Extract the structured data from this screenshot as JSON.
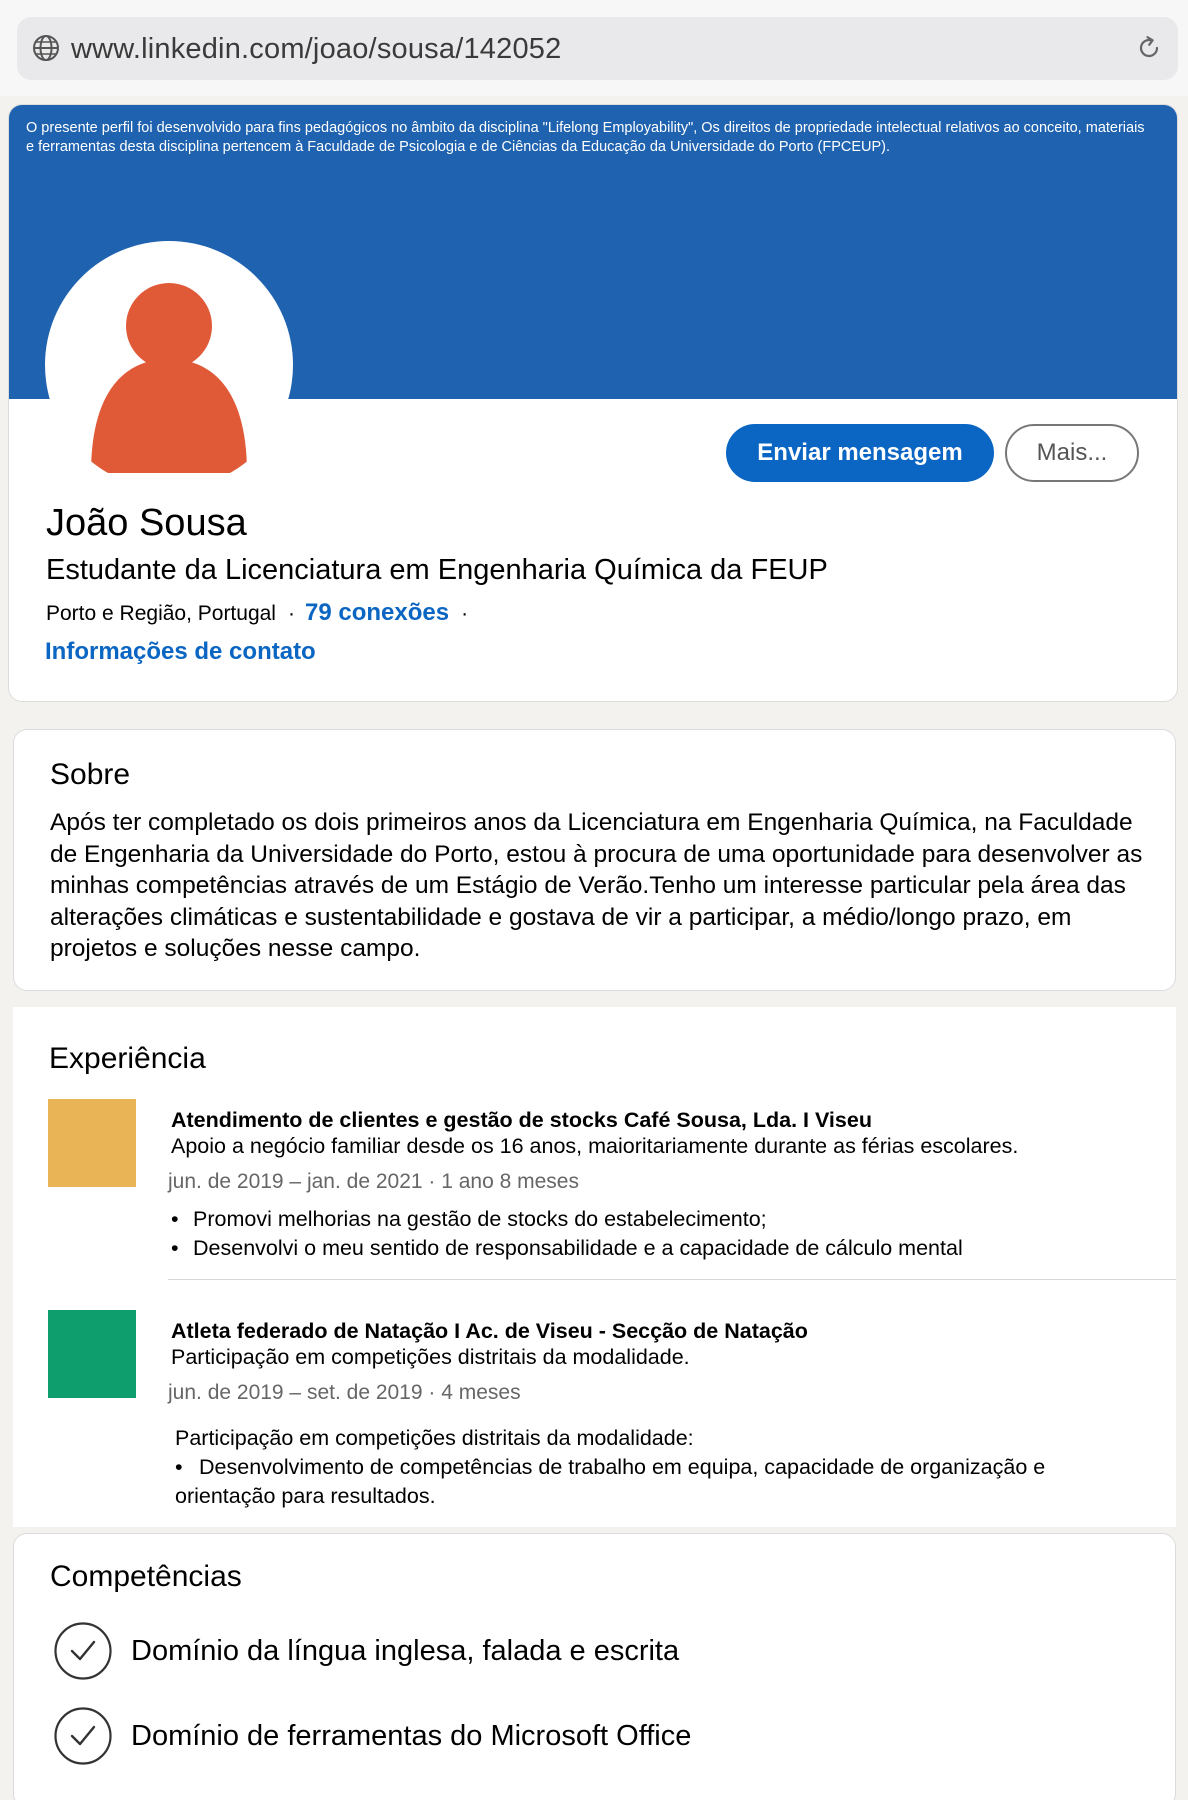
{
  "browser": {
    "url": "www.linkedin.com/joao/sousa/142052"
  },
  "banner": {
    "notice": "O presente perfil foi desenvolvido para fins pedagógicos no âmbito da disciplina \"Lifelong Employability\", Os direitos de propriedade intelectual relativos ao conceito, materiais e ferramentas desta disciplina pertencem à Faculdade de Psicologia e de Ciências da Educação da Universidade do Porto (FPCEUP)."
  },
  "profile": {
    "name": "João Sousa",
    "headline": "Estudante da Licenciatura em Engenharia Química da FEUP",
    "location": "Porto e Região, Portugal",
    "separator": "·",
    "connections": "79 conexões",
    "contact_link": "Informações de contato",
    "avatar_color": "#e05a38"
  },
  "actions": {
    "message_label": "Enviar mensagem",
    "more_label": "Mais..."
  },
  "about": {
    "title": "Sobre",
    "text": "Após ter completado os dois primeiros anos da Licenciatura em Engenharia Química, na Faculdade de Engenharia da Universidade do Porto, estou à procura de uma oportunidade para desenvolver as minhas competências através de um Estágio de Verão.Tenho um interesse particular pela área das alterações climáticas e sustentabilidade e gostava de vir a participar, a médio/longo prazo, em projetos e soluções nesse campo."
  },
  "experience": {
    "title": "Experiência",
    "items": [
      {
        "title": "Atendimento de clientes e gestão de stocks Café Sousa, Lda. I Viseu",
        "description": "Apoio a negócio familiar desde os 16 anos, maioritariamente durante as férias escolares.",
        "dates": "jun. de 2019 – jan. de 2021 · 1 ano 8 meses",
        "logo_color": "#e8b455",
        "bullets": [
          "Promovi melhorias na gestão de stocks do estabelecimento;",
          "Desenvolvi o meu sentido de responsabilidade e a capacidade de cálculo mental"
        ]
      },
      {
        "title": "Atleta federado de Natação I Ac. de Viseu - Secção de Natação",
        "description": "Participação em competições distritais da modalidade.",
        "dates": "jun. de 2019 – set. de 2019 · 4 meses",
        "logo_color": "#0e9e6e",
        "detail_intro": "Participação em competições distritais da modalidade:",
        "detail_bullet": "Desenvolvimento de competências de trabalho em equipa, capacidade de organização e orientação para resultados."
      }
    ]
  },
  "skills": {
    "title": "Competências",
    "items": [
      "Domínio da língua inglesa, falada e escrita",
      "Domínio de ferramentas do Microsoft Office"
    ]
  },
  "colors": {
    "linkedin_blue": "#0a66c2",
    "banner_blue": "#1f63b0"
  }
}
